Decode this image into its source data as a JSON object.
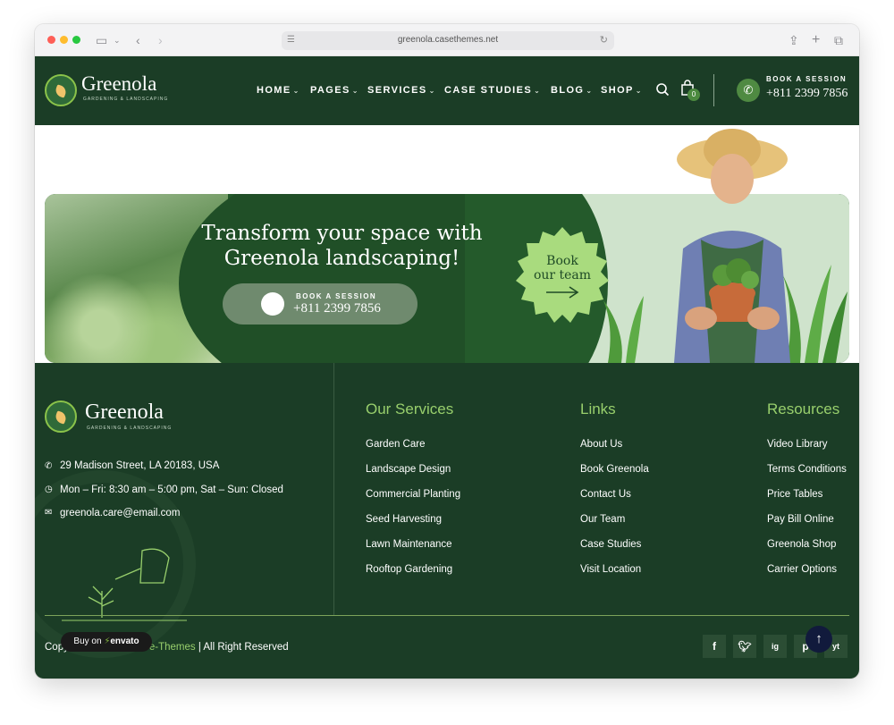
{
  "browser": {
    "url": "greenola.casethemes.net"
  },
  "header": {
    "logo_name": "Greenola",
    "logo_tagline": "GARDENING & LANDSCAPING",
    "nav": [
      {
        "label": "HOME"
      },
      {
        "label": "PAGES"
      },
      {
        "label": "SERVICES"
      },
      {
        "label": "CASE STUDIES"
      },
      {
        "label": "BLOG"
      },
      {
        "label": "SHOP"
      }
    ],
    "cart_count": "0",
    "book_label": "BOOK A SESSION",
    "phone": "+811 2399 7856"
  },
  "banner": {
    "title": "Transform your space with Greenola landscaping!",
    "book_label": "BOOK A SESSION",
    "phone": "+811 2399 7856",
    "badge_text_line1": "Book",
    "badge_text_line2": "our team"
  },
  "footer": {
    "logo_name": "Greenola",
    "logo_tagline": "GARDENING & LANDSCAPING",
    "address": "29 Madison Street, LA 20183, USA",
    "hours": "Mon – Fri: 8:30 am – 5:00 pm, Sat – Sun: Closed",
    "email": "greenola.care@email.com",
    "columns": [
      {
        "heading": "Our Services",
        "links": [
          "Garden Care",
          "Landscape Design",
          "Commercial Planting",
          "Seed Harvesting",
          "Lawn Maintenance",
          "Rooftop Gardening"
        ]
      },
      {
        "heading": "Links",
        "links": [
          "About Us",
          "Book Greenola",
          "Contact Us",
          "Our Team",
          "Case Studies",
          "Visit Location"
        ]
      },
      {
        "heading": "Resources",
        "links": [
          "Video Library",
          "Terms Conditions",
          "Price Tables",
          "Pay Bill Online",
          "Greenola Shop",
          "Carrier Options"
        ]
      }
    ],
    "copyright_prefix": "Copy",
    "copyright_brand": "e-Themes",
    "copyright_suffix": "| All Right Reserved",
    "envato_prefix": "Buy on",
    "envato_brand": "envato",
    "social": [
      "f",
      "t",
      "ig",
      "p",
      "yt"
    ]
  },
  "colors": {
    "dark_green": "#1b3d26",
    "accent_green": "#98cf6c",
    "light_green": "#cfe3cc"
  }
}
